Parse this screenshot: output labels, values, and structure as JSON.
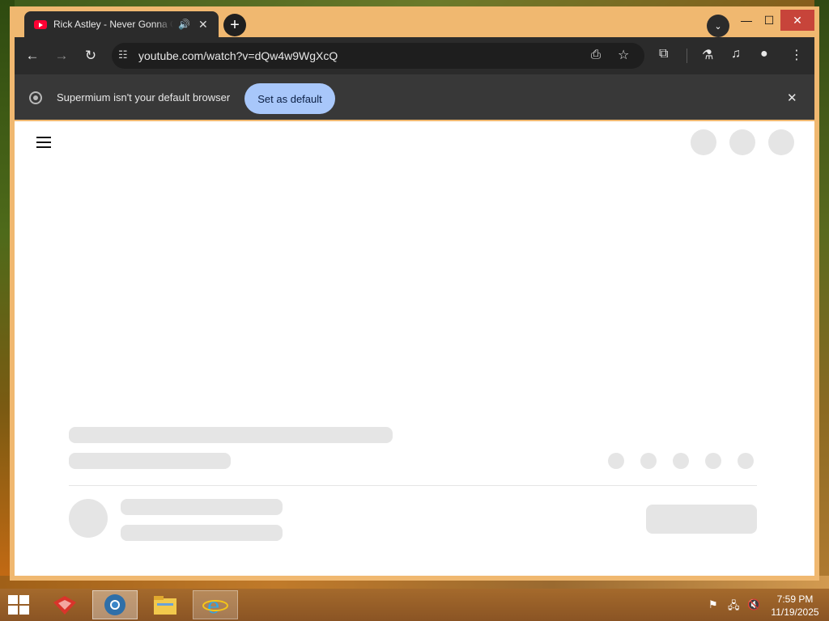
{
  "browser": {
    "tab": {
      "title": "Rick Astley - Never Gonna Give You Up",
      "audio_icon": "speaker-icon"
    },
    "url": "youtube.com/watch?v=dQw4w9WgXcQ",
    "infobar": {
      "message": "Supermium isn't your default browser",
      "button": "Set as default"
    },
    "colors": {
      "toolbar": "#2b2b2b",
      "frame": "#f0b870",
      "accent_button": "#a8c7fa"
    }
  },
  "taskbar": {
    "time": "7:59 PM",
    "date": "11/19/2025",
    "apps": [
      "red-shield-icon",
      "supermium-browser-icon",
      "file-explorer-icon",
      "internet-explorer-icon"
    ]
  }
}
